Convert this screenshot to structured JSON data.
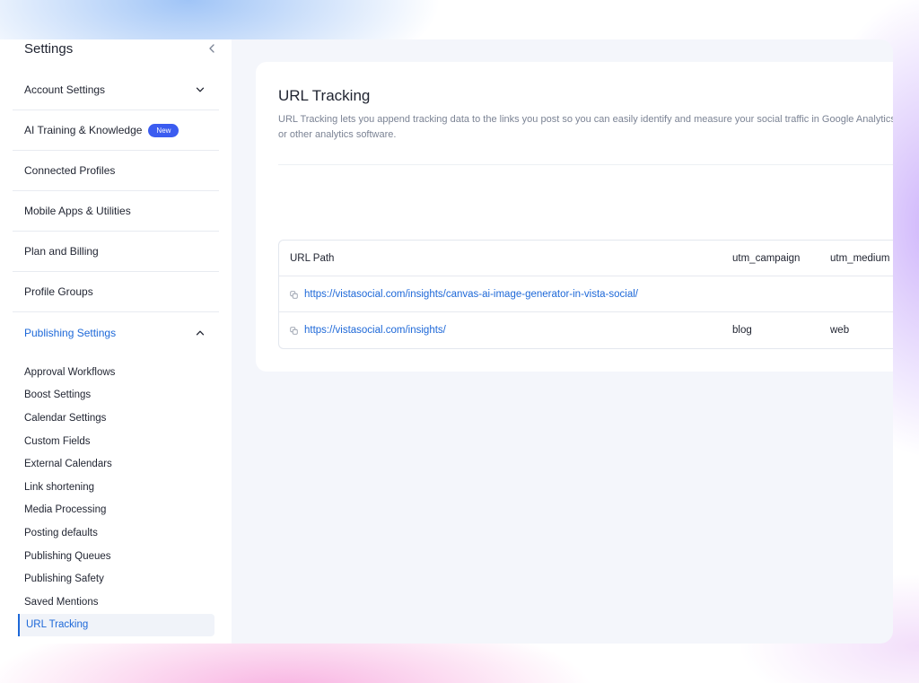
{
  "sidebar": {
    "title": "Settings",
    "items": [
      {
        "label": "Account Settings",
        "chevron": "down"
      },
      {
        "label": "AI Training & Knowledge",
        "badge": "New"
      },
      {
        "label": "Connected Profiles"
      },
      {
        "label": "Mobile Apps & Utilities"
      },
      {
        "label": "Plan and Billing"
      },
      {
        "label": "Profile Groups"
      },
      {
        "label": "Publishing Settings",
        "chevron": "up",
        "active": true
      }
    ],
    "sub_items": [
      {
        "label": "Approval Workflows"
      },
      {
        "label": "Boost Settings"
      },
      {
        "label": "Calendar Settings"
      },
      {
        "label": "Custom Fields"
      },
      {
        "label": "External Calendars"
      },
      {
        "label": "Link shortening"
      },
      {
        "label": "Media Processing"
      },
      {
        "label": "Posting defaults"
      },
      {
        "label": "Publishing Queues"
      },
      {
        "label": "Publishing Safety"
      },
      {
        "label": "Saved Mentions"
      },
      {
        "label": "URL Tracking",
        "active": true
      }
    ]
  },
  "main": {
    "title": "URL Tracking",
    "description": "URL Tracking lets you append tracking data to the links you post so you can easily identify and measure your social traffic in Google Analytics or other analytics software.",
    "table": {
      "columns": [
        "URL Path",
        "utm_campaign",
        "utm_medium"
      ],
      "rows": [
        {
          "url": "https://vistasocial.com/insights/canvas-ai-image-generator-in-vista-social/",
          "utm_campaign": "",
          "utm_medium": ""
        },
        {
          "url": "https://vistasocial.com/insights/",
          "utm_campaign": "blog",
          "utm_medium": "web"
        }
      ]
    }
  },
  "icons": {
    "collapse": "chevron-left-icon",
    "expand": "chevron-down-icon",
    "collapse_section": "chevron-up-icon",
    "link": "link-icon"
  },
  "colors": {
    "accent": "#1d68d8",
    "badge": "#3b5cf0",
    "text": "#1f2330",
    "muted": "#7b8394",
    "surface": "#f4f6fb"
  }
}
